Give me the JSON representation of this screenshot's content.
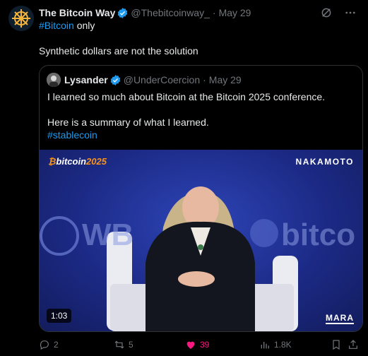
{
  "tweet": {
    "author_name": "The Bitcoin Way",
    "author_handle": "@Thebitcoinway_",
    "separator": "·",
    "date": "May 29",
    "hashtag": "#Bitcoin",
    "hashtag_suffix": " only",
    "text": "Synthetic dollars are not the solution"
  },
  "quote": {
    "author_name": "Lysander",
    "author_handle": "@UnderCoercion",
    "separator": "·",
    "date": "May 29",
    "line1": "I learned so much about Bitcoin at the Bitcoin 2025 conference.",
    "line2": "Here is a summary of what I learned.",
    "line3": "#stablecoin",
    "video": {
      "logo_prefix": "₿",
      "logo_text": "bitcoin",
      "logo_year": "2025",
      "brand_right": "NAKAMOTO",
      "brand_bottom": "MARA",
      "duration": "1:03",
      "backdrop_text_left": "WB",
      "backdrop_text_right": "bitco"
    }
  },
  "actions": {
    "replies": "2",
    "reposts": "5",
    "likes": "39",
    "views": "1.8K"
  },
  "icons": {
    "header": [
      "grok-icon",
      "more-icon"
    ],
    "actions": [
      "reply-icon",
      "repost-icon",
      "like-icon",
      "views-icon",
      "bookmark-icon",
      "share-icon"
    ]
  },
  "colors": {
    "background": "#000000",
    "text": "#e7e9ea",
    "muted": "#71767b",
    "link": "#1d9bf0",
    "like": "#f91880",
    "verified": "#1d9bf0",
    "video_bg": "#1c2a86"
  }
}
